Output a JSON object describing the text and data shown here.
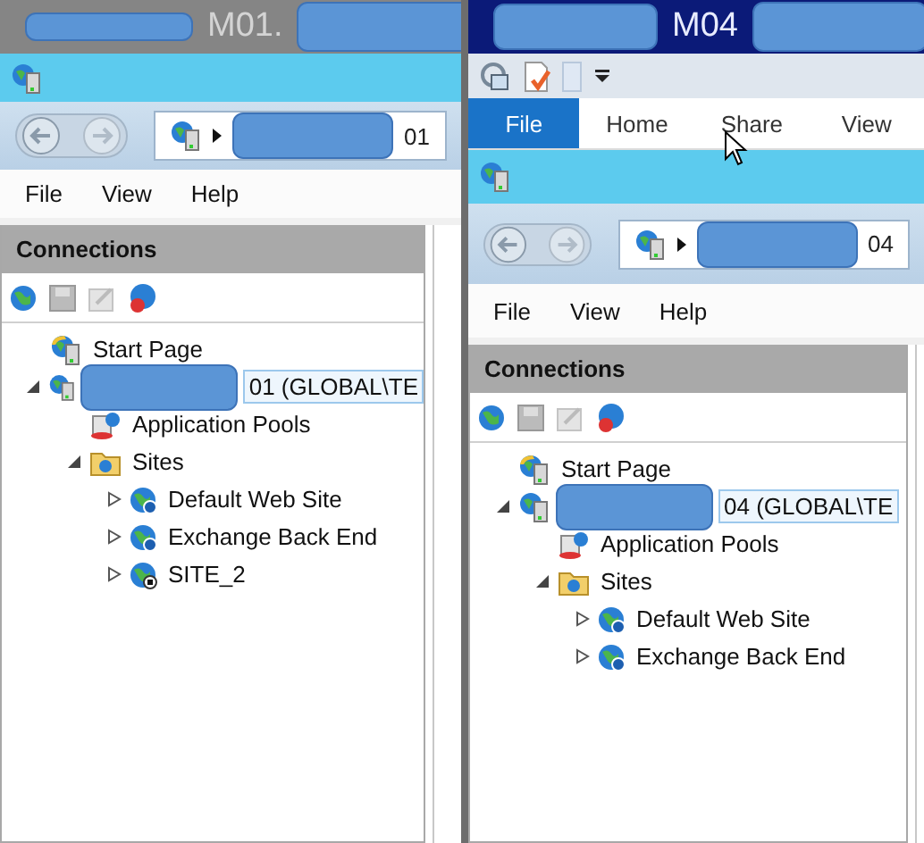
{
  "windows": [
    {
      "title": "M01.",
      "active": false,
      "address": "01",
      "menu": [
        "File",
        "View",
        "Help"
      ],
      "panel_title": "Connections",
      "tree": [
        {
          "label": "Start Page",
          "kind": "start",
          "selected": false
        },
        {
          "label": "01 (GLOBAL\\TE",
          "kind": "server",
          "selected": true,
          "expanded": true,
          "children": [
            {
              "label": "Application Pools",
              "kind": "pools",
              "selected": false
            },
            {
              "label": "Sites",
              "kind": "sites",
              "selected": false,
              "expanded": true,
              "children": [
                {
                  "label": "Default Web Site",
                  "kind": "site",
                  "selected": false,
                  "expanded": false
                },
                {
                  "label": "Exchange Back End",
                  "kind": "site",
                  "selected": false,
                  "expanded": false
                },
                {
                  "label": "SITE_2",
                  "kind": "site-stopped",
                  "selected": false,
                  "expanded": false
                }
              ]
            }
          ]
        }
      ]
    },
    {
      "title": "M04",
      "active": true,
      "ribbon_tabs": [
        {
          "label": "File",
          "selected": true
        },
        {
          "label": "Home",
          "selected": false
        },
        {
          "label": "Share",
          "selected": false
        },
        {
          "label": "View",
          "selected": false
        }
      ],
      "address": "04",
      "menu": [
        "File",
        "View",
        "Help"
      ],
      "panel_title": "Connections",
      "tree": [
        {
          "label": "Start Page",
          "kind": "start",
          "selected": false
        },
        {
          "label": "04 (GLOBAL\\TE",
          "kind": "server",
          "selected": true,
          "expanded": true,
          "children": [
            {
              "label": "Application Pools",
              "kind": "pools",
              "selected": false
            },
            {
              "label": "Sites",
              "kind": "sites",
              "selected": false,
              "expanded": true,
              "children": [
                {
                  "label": "Default Web Site",
                  "kind": "site",
                  "selected": false,
                  "expanded": false
                },
                {
                  "label": "Exchange Back End",
                  "kind": "site",
                  "selected": false,
                  "expanded": false
                }
              ]
            }
          ]
        }
      ]
    }
  ]
}
